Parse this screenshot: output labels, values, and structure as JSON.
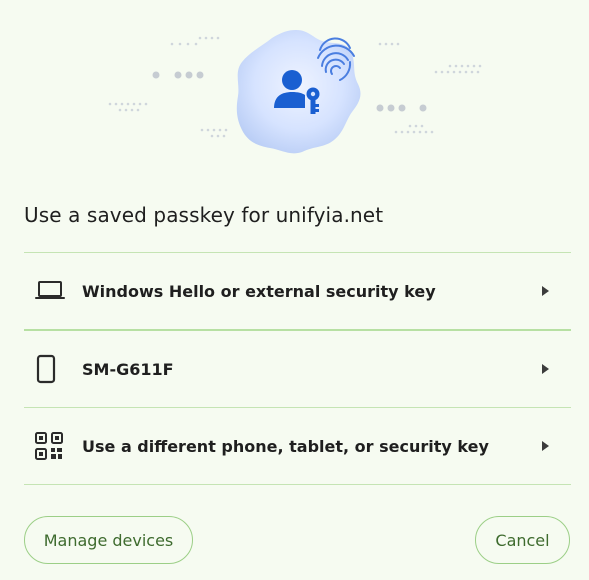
{
  "dialog": {
    "title": "Use a saved passkey for unifyia.net"
  },
  "options": [
    {
      "label": "Windows Hello or external security key",
      "icon": "laptop-icon"
    },
    {
      "label": "SM-G611F",
      "icon": "phone-icon"
    },
    {
      "label": "Use a different phone, tablet, or security key",
      "icon": "qr-code-icon"
    }
  ],
  "buttons": {
    "manage_label": "Manage devices",
    "cancel_label": "Cancel"
  },
  "colors": {
    "background": "#f6fbf1",
    "divider": "#c5e4b4",
    "button_border": "#9ccf87",
    "button_text": "#3e6b2e",
    "illustration_blue": "#1a5fd1"
  }
}
